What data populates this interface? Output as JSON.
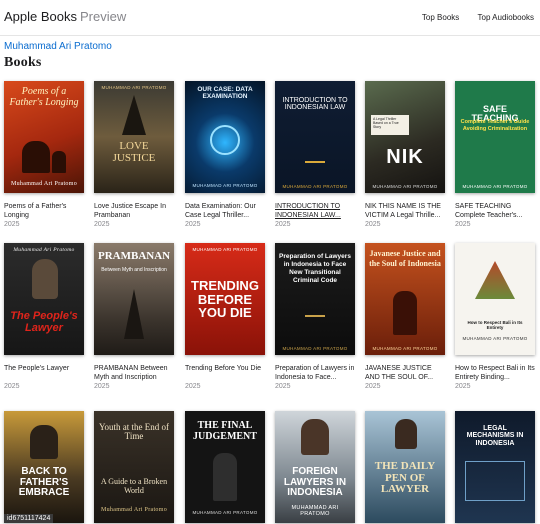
{
  "header": {
    "brand_strong": "Apple Books",
    "brand_light": "Preview",
    "nav": [
      "Top Books",
      "Top Audiobooks"
    ]
  },
  "author_name": "Muhammad Ari Pratomo",
  "section_title": "Books",
  "books": [
    {
      "title": "Poems of a Father's Longing",
      "year": "2025",
      "cover_title": "Poems of a Father's Longing",
      "cover_author": "Muhammad Ari Pratomo"
    },
    {
      "title": "Love Justice Escape In Prambanan",
      "year": "2025",
      "cover_title": "LOVE JUSTICE",
      "cover_author": "MUHAMMAD ARI PRATOMO"
    },
    {
      "title": "Data Examination: Our Case Legal Thriller...",
      "year": "2025",
      "cover_title": "OUR CASE: DATA EXAMINATION",
      "cover_author": "MUHAMMAD ARI PRATOMO"
    },
    {
      "title": "INTRODUCTION TO INDONESIAN LAW...",
      "year": "2025",
      "cover_title": "INTRODUCTION TO INDONESIAN LAW",
      "cover_author": "MUHAMMAD ARI PRATOMO"
    },
    {
      "title": "NIK THIS NAME IS THE VICTIM A Legal Thrille...",
      "year": "2025",
      "cover_title": "NIK",
      "cover_author": "MUHAMMAD ARI PRATOMO"
    },
    {
      "title": "SAFE TEACHING Complete Teacher's...",
      "year": "2025",
      "cover_title": "SAFE TEACHING",
      "cover_author": "MUHAMMAD ARI PRATOMO"
    },
    {
      "title": "The People's Lawyer",
      "year": "2025",
      "cover_title": "The People's Lawyer",
      "cover_author": "Muhammad Ari Pratomo"
    },
    {
      "title": "PRAMBANAN Between Myth and Inscription",
      "year": "2025",
      "cover_title": "PRAMBANAN",
      "cover_author": "MUHAMMAD ARI PRATOMO"
    },
    {
      "title": "Trending Before You Die",
      "year": "2025",
      "cover_title": "TRENDING BEFORE YOU DIE",
      "cover_author": "MUHAMMAD ARI PRATOMO"
    },
    {
      "title": "Preparation of Lawyers in Indonesia to Face...",
      "year": "2025",
      "cover_title": "Preparation of Lawyers in Indonesia to Face New Transitional Criminal Code",
      "cover_author": "MUHAMMAD ARI PRATOMO"
    },
    {
      "title": "JAVANESE JUSTICE AND THE SOUL OF...",
      "year": "2025",
      "cover_title": "Javanese Justice and the Soul of Indonesia",
      "cover_author": "MUHAMMAD ARI PRATOMO"
    },
    {
      "title": "How to Respect Bali in Its Entirety Binding...",
      "year": "2025",
      "cover_title": "How to Respect Bali in Its Entirety",
      "cover_author": "MUHAMMAD ARI PRATOMO"
    },
    {
      "title": "",
      "year": "",
      "cover_title": "BACK TO FATHER'S EMBRACE",
      "cover_author": ""
    },
    {
      "title": "",
      "year": "",
      "cover_title": "Youth at the End of Time",
      "cover_author": "Muhammad Ari Pratomo"
    },
    {
      "title": "",
      "year": "",
      "cover_title": "THE FINAL JUDGEMENT",
      "cover_author": "MUHAMMAD ARI PRATOMO"
    },
    {
      "title": "",
      "year": "",
      "cover_title": "FOREIGN LAWYERS IN INDONESIA",
      "cover_author": "MUHAMMAD ARI PRATOMO"
    },
    {
      "title": "",
      "year": "",
      "cover_title": "THE DAILY PEN OF LAWYER",
      "cover_author": ""
    },
    {
      "title": "",
      "year": "",
      "cover_title": "LEGAL MECHANISMS IN INDONESIA",
      "cover_author": ""
    }
  ],
  "cover_subtitles": {
    "b2": "A Guide to a Broken World",
    "b7": "Between Myth and Inscription",
    "b2_youth": "A Guide to a Broken World"
  },
  "id_badge": "id6751117424",
  "colors": {
    "link": "#0a6ccf",
    "muted": "#86868b"
  }
}
